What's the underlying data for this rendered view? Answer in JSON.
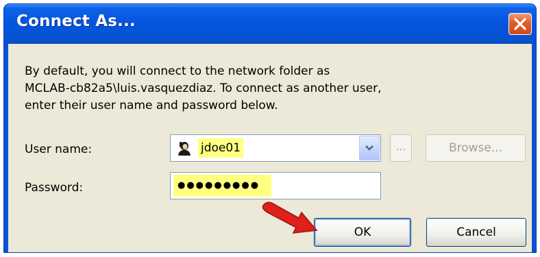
{
  "window": {
    "title": "Connect As..."
  },
  "description": {
    "lines": [
      "By default, you will connect to the network folder as",
      "MCLAB-cb82a5\\luis.vasquezdiaz. To connect as another user,",
      "enter their user name and password below."
    ]
  },
  "form": {
    "username_label": "User name:",
    "username_value": "jdoe01",
    "password_label": "Password:",
    "password_masked": "●●●●●●●●●"
  },
  "buttons": {
    "ellipsis": "...",
    "browse": "Browse...",
    "ok": "OK",
    "cancel": "Cancel"
  },
  "colors": {
    "titlebar": "#0555e0",
    "highlight": "#ffff80",
    "arrow": "#e0201a",
    "dialog_bg": "#ece9d8"
  },
  "icons": {
    "close": "close-icon",
    "user": "user-icon",
    "dropdown": "chevron-down-icon",
    "annotation": "red-arrow-icon"
  }
}
